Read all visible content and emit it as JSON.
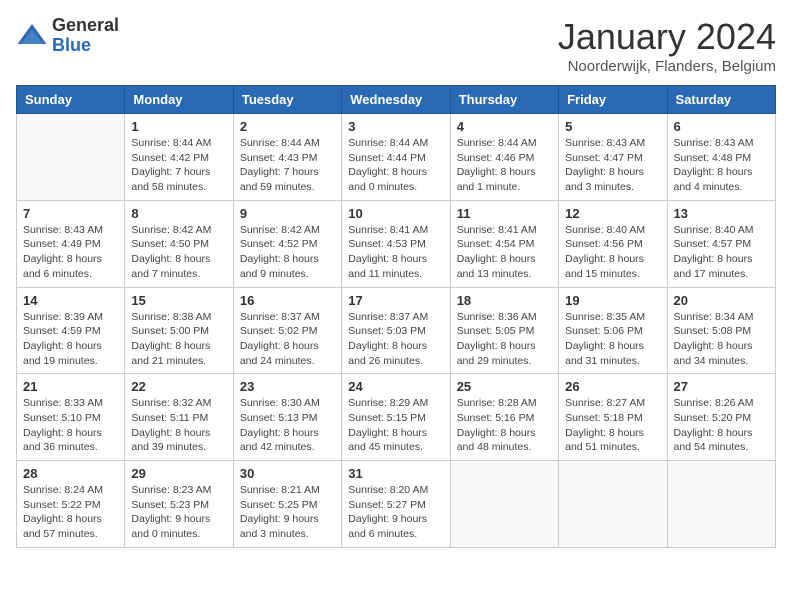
{
  "logo": {
    "general": "General",
    "blue": "Blue"
  },
  "title": "January 2024",
  "location": "Noorderwijk, Flanders, Belgium",
  "days_of_week": [
    "Sunday",
    "Monday",
    "Tuesday",
    "Wednesday",
    "Thursday",
    "Friday",
    "Saturday"
  ],
  "weeks": [
    [
      {
        "day": "",
        "info": ""
      },
      {
        "day": "1",
        "info": "Sunrise: 8:44 AM\nSunset: 4:42 PM\nDaylight: 7 hours\nand 58 minutes."
      },
      {
        "day": "2",
        "info": "Sunrise: 8:44 AM\nSunset: 4:43 PM\nDaylight: 7 hours\nand 59 minutes."
      },
      {
        "day": "3",
        "info": "Sunrise: 8:44 AM\nSunset: 4:44 PM\nDaylight: 8 hours\nand 0 minutes."
      },
      {
        "day": "4",
        "info": "Sunrise: 8:44 AM\nSunset: 4:46 PM\nDaylight: 8 hours\nand 1 minute."
      },
      {
        "day": "5",
        "info": "Sunrise: 8:43 AM\nSunset: 4:47 PM\nDaylight: 8 hours\nand 3 minutes."
      },
      {
        "day": "6",
        "info": "Sunrise: 8:43 AM\nSunset: 4:48 PM\nDaylight: 8 hours\nand 4 minutes."
      }
    ],
    [
      {
        "day": "7",
        "info": "Sunrise: 8:43 AM\nSunset: 4:49 PM\nDaylight: 8 hours\nand 6 minutes."
      },
      {
        "day": "8",
        "info": "Sunrise: 8:42 AM\nSunset: 4:50 PM\nDaylight: 8 hours\nand 7 minutes."
      },
      {
        "day": "9",
        "info": "Sunrise: 8:42 AM\nSunset: 4:52 PM\nDaylight: 8 hours\nand 9 minutes."
      },
      {
        "day": "10",
        "info": "Sunrise: 8:41 AM\nSunset: 4:53 PM\nDaylight: 8 hours\nand 11 minutes."
      },
      {
        "day": "11",
        "info": "Sunrise: 8:41 AM\nSunset: 4:54 PM\nDaylight: 8 hours\nand 13 minutes."
      },
      {
        "day": "12",
        "info": "Sunrise: 8:40 AM\nSunset: 4:56 PM\nDaylight: 8 hours\nand 15 minutes."
      },
      {
        "day": "13",
        "info": "Sunrise: 8:40 AM\nSunset: 4:57 PM\nDaylight: 8 hours\nand 17 minutes."
      }
    ],
    [
      {
        "day": "14",
        "info": "Sunrise: 8:39 AM\nSunset: 4:59 PM\nDaylight: 8 hours\nand 19 minutes."
      },
      {
        "day": "15",
        "info": "Sunrise: 8:38 AM\nSunset: 5:00 PM\nDaylight: 8 hours\nand 21 minutes."
      },
      {
        "day": "16",
        "info": "Sunrise: 8:37 AM\nSunset: 5:02 PM\nDaylight: 8 hours\nand 24 minutes."
      },
      {
        "day": "17",
        "info": "Sunrise: 8:37 AM\nSunset: 5:03 PM\nDaylight: 8 hours\nand 26 minutes."
      },
      {
        "day": "18",
        "info": "Sunrise: 8:36 AM\nSunset: 5:05 PM\nDaylight: 8 hours\nand 29 minutes."
      },
      {
        "day": "19",
        "info": "Sunrise: 8:35 AM\nSunset: 5:06 PM\nDaylight: 8 hours\nand 31 minutes."
      },
      {
        "day": "20",
        "info": "Sunrise: 8:34 AM\nSunset: 5:08 PM\nDaylight: 8 hours\nand 34 minutes."
      }
    ],
    [
      {
        "day": "21",
        "info": "Sunrise: 8:33 AM\nSunset: 5:10 PM\nDaylight: 8 hours\nand 36 minutes."
      },
      {
        "day": "22",
        "info": "Sunrise: 8:32 AM\nSunset: 5:11 PM\nDaylight: 8 hours\nand 39 minutes."
      },
      {
        "day": "23",
        "info": "Sunrise: 8:30 AM\nSunset: 5:13 PM\nDaylight: 8 hours\nand 42 minutes."
      },
      {
        "day": "24",
        "info": "Sunrise: 8:29 AM\nSunset: 5:15 PM\nDaylight: 8 hours\nand 45 minutes."
      },
      {
        "day": "25",
        "info": "Sunrise: 8:28 AM\nSunset: 5:16 PM\nDaylight: 8 hours\nand 48 minutes."
      },
      {
        "day": "26",
        "info": "Sunrise: 8:27 AM\nSunset: 5:18 PM\nDaylight: 8 hours\nand 51 minutes."
      },
      {
        "day": "27",
        "info": "Sunrise: 8:26 AM\nSunset: 5:20 PM\nDaylight: 8 hours\nand 54 minutes."
      }
    ],
    [
      {
        "day": "28",
        "info": "Sunrise: 8:24 AM\nSunset: 5:22 PM\nDaylight: 8 hours\nand 57 minutes."
      },
      {
        "day": "29",
        "info": "Sunrise: 8:23 AM\nSunset: 5:23 PM\nDaylight: 9 hours\nand 0 minutes."
      },
      {
        "day": "30",
        "info": "Sunrise: 8:21 AM\nSunset: 5:25 PM\nDaylight: 9 hours\nand 3 minutes."
      },
      {
        "day": "31",
        "info": "Sunrise: 8:20 AM\nSunset: 5:27 PM\nDaylight: 9 hours\nand 6 minutes."
      },
      {
        "day": "",
        "info": ""
      },
      {
        "day": "",
        "info": ""
      },
      {
        "day": "",
        "info": ""
      }
    ]
  ]
}
